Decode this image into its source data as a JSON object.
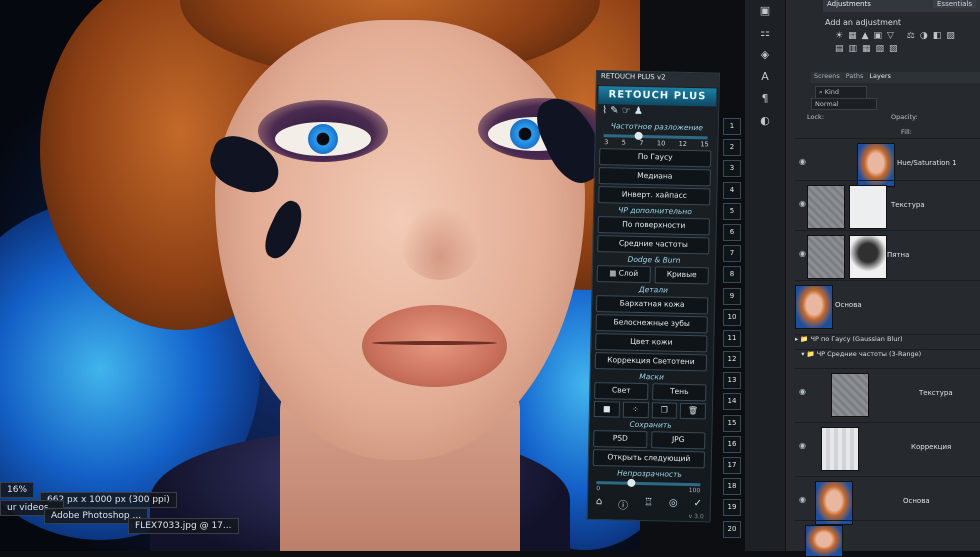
{
  "taskbar": {
    "status_zoom": "16%",
    "doc_info": "662 px x 1000 px (300 ppi)",
    "item_videos": "ur videos...",
    "item_photoshop": "Adobe Photoshop ...",
    "item_file": "FLEX7033.jpg @ 17..."
  },
  "plugin": {
    "window_title": "RETOUCH PLUS v2",
    "logo": "RETOUCH PLUS",
    "freq_section": "Частотное разложение",
    "freq_scale": [
      "3",
      "5",
      "7",
      "10",
      "12",
      "15"
    ],
    "buttons_blur": [
      "По Гаусу",
      "Медиана",
      "Инверт. хайпасс"
    ],
    "hf_extra_section": "ЧР дополнительно",
    "buttons_extra": [
      "По поверхности",
      "Средние частоты"
    ],
    "dodge_section": "Dodge & Burn",
    "dodge_layer": "Слой",
    "dodge_curves": "Кривые",
    "details_section": "Детали",
    "buttons_details": [
      "Бархатная кожа",
      "Белоснежные зубы",
      "Цвет кожи",
      "Коррекция Светотени"
    ],
    "masks_section": "Маски",
    "mask_light": "Свет",
    "mask_shadow": "Тень",
    "save_section": "Сохранить",
    "save_psd": "PSD",
    "save_jpg": "JPG",
    "open_next": "Открыть следующий",
    "opacity_section": "Непрозрачность",
    "opacity_min": "0",
    "opacity_max": "100",
    "opacity_value": 0.3,
    "version": "v 3.0",
    "numbers": [
      "1",
      "2",
      "3",
      "4",
      "5",
      "6",
      "7",
      "8",
      "9",
      "10",
      "11",
      "12",
      "13",
      "14",
      "15",
      "16",
      "17",
      "18",
      "19",
      "20"
    ]
  },
  "dock": {
    "adjustments_tab": "Adjustments",
    "add_adjustment": "Add an adjustment",
    "essentials": "Essentials",
    "tabs": [
      "Screens",
      "Paths",
      "Layers"
    ],
    "active_tab": "Layers",
    "kind_label": "Kind",
    "blend_mode": "Normal",
    "opacity_label": "Opacity:",
    "lock_label": "Lock:",
    "fill_label": "Fill:",
    "layers": [
      {
        "name": "Hue/Saturation 1"
      },
      {
        "name": "Текстура"
      },
      {
        "name": "Пятна"
      },
      {
        "name": "Основа"
      }
    ],
    "group_1": "ЧР по Гаусу (Gaussian Blur)",
    "group_2": "ЧР Средние частоты (3-Range)",
    "layers_2": [
      {
        "name": "Текстура"
      },
      {
        "name": "Коррекция"
      },
      {
        "name": "Основа"
      }
    ]
  }
}
